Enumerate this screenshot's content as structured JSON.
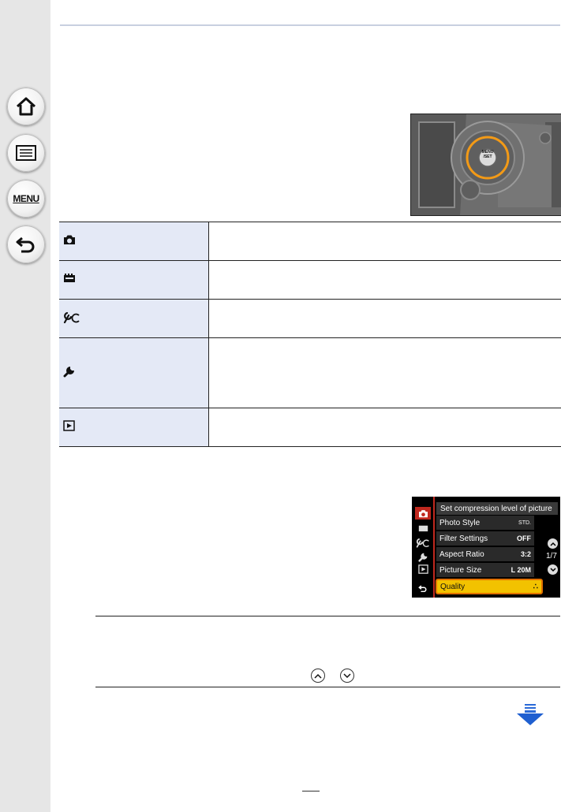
{
  "sidebar": {
    "home_icon": "home-icon",
    "contents_icon": "list-icon",
    "menu_label": "MENU",
    "back_icon": "back-arrow-icon"
  },
  "camera_photo": {
    "button_label_1": "MENU",
    "button_label_2": "/SET"
  },
  "menu_table": {
    "rows": [
      {
        "icon": "camera-icon"
      },
      {
        "icon": "motion-picture-icon"
      },
      {
        "icon": "custom-icon"
      },
      {
        "icon": "setup-wrench-icon"
      },
      {
        "icon": "playback-icon"
      }
    ]
  },
  "camera_menu": {
    "hint": "Set compression level of picture",
    "items": [
      {
        "label": "Photo Style",
        "value": "STD."
      },
      {
        "label": "Filter Settings",
        "value": "OFF"
      },
      {
        "label": "Aspect Ratio",
        "value": "3:2"
      },
      {
        "label": "Picture Size",
        "value": "L 20M"
      },
      {
        "label": "Quality",
        "value": "∴"
      }
    ],
    "page_indicator": "1/7",
    "colors": {
      "highlight": "#f2c200",
      "highlight_border": "#e07000",
      "tab_active": "#c0281e"
    }
  },
  "scroll_buttons": {
    "up_icon": "chevron-up-icon",
    "down_icon": "chevron-down-icon"
  },
  "continue_icon": "next-page-arrow-icon"
}
